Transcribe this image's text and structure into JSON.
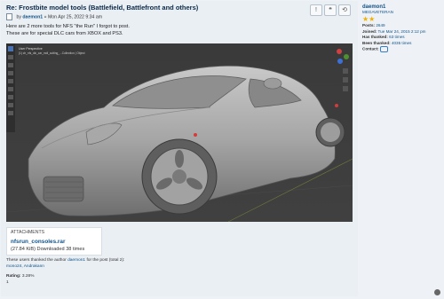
{
  "post": {
    "title": "Re: Frostbite model tools (Battlefield, Battlefront and others)",
    "meta_by": "by",
    "author": "daemon1",
    "date": "» Mon Apr 25, 2022 9:34 am",
    "line1": "Here are 2 more tools for NFS \"the Run\" I forgot to post.",
    "line2": "These are for special DLC cars from XBOX and PS3."
  },
  "viewport": {
    "header": "User Perspective",
    "subheader": "(1) ch_nfs_dlc_car_mdl_cutting_...Collection | Object"
  },
  "attachment": {
    "header": "ATTACHMENTS",
    "filename": "nfsrun_consoles.rar",
    "info": "(27.84 KiB) Downloaded 38 times"
  },
  "thanks": {
    "prefix": "These users thanked the author",
    "author": "daemon1",
    "suffix": "for the post (total 2):",
    "users": "mono24, Andrakann"
  },
  "rating": {
    "label": "Rating:",
    "value": "3.28%",
    "number": "1"
  },
  "profile": {
    "username": "daemon1",
    "rank": "MEGAVETERAN",
    "stars": "★★",
    "posts_label": "Posts:",
    "posts_value": "2649",
    "joined_label": "Joined:",
    "joined_value": "Tue Mar 24, 2015 2:12 pm",
    "thanked_label": "Has thanked:",
    "thanked_value": "63 times",
    "been_thanked_label": "Been thanked:",
    "been_thanked_value": "4035 times",
    "contact_label": "Contact:"
  },
  "icons": {
    "quote": "quote-icon",
    "report": "report-icon",
    "warn": "warning-icon",
    "contact": "contact-icon"
  }
}
